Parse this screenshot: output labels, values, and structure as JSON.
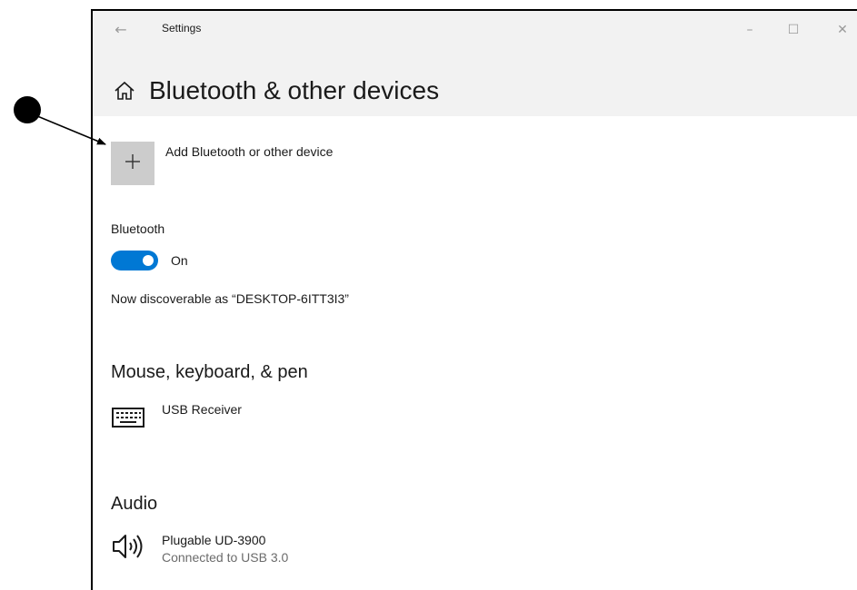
{
  "window": {
    "app_title": "Settings",
    "back_icon": "back-arrow-icon",
    "controls": {
      "minimize_icon": "minimize-icon",
      "maximize_icon": "maximize-icon",
      "close_icon": "close-icon"
    }
  },
  "page": {
    "title": "Bluetooth & other devices",
    "home_icon": "home-icon"
  },
  "add_device": {
    "label": "Add Bluetooth or other device",
    "icon": "plus-icon"
  },
  "bluetooth": {
    "label": "Bluetooth",
    "toggle_state": "On",
    "enabled": true,
    "discoverable_text": "Now discoverable as “DESKTOP-6ITT3I3”"
  },
  "groups": {
    "mouse_keyboard_pen": {
      "heading": "Mouse, keyboard, & pen",
      "devices": [
        {
          "name": "USB Receiver",
          "status": "",
          "icon": "keyboard-icon"
        }
      ]
    },
    "audio": {
      "heading": "Audio",
      "devices": [
        {
          "name": "Plugable UD-3900",
          "status": "Connected to USB 3.0",
          "icon": "speaker-icon"
        }
      ]
    }
  },
  "colors": {
    "accent": "#0078d4",
    "header_band": "#f2f2f2",
    "add_tile": "#cccccc",
    "secondary_text": "#6b6b6b"
  }
}
